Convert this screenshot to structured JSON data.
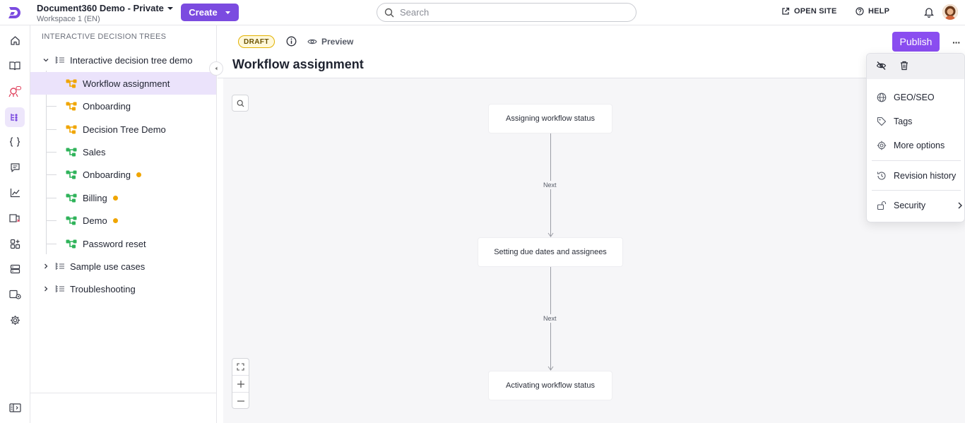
{
  "header": {
    "project_title": "Document360 Demo - Private",
    "workspace": "Workspace 1 (EN)",
    "create_label": "Create",
    "search_placeholder": "Search",
    "open_site_label": "OPEN SITE",
    "help_label": "HELP"
  },
  "rail": {
    "items": [
      "home-icon",
      "book-icon",
      "ai-assistant-icon",
      "decision-tree-icon",
      "api-braces-icon",
      "feedback-icon",
      "analytics-icon",
      "knowledge-base-icon",
      "apps-icon",
      "drive-icon",
      "widget-icon",
      "settings-icon",
      "sidebar-toggle-icon"
    ],
    "active": "decision-tree-icon"
  },
  "tree": {
    "heading": "INTERACTIVE DECISION TREES",
    "folders": [
      {
        "label": "Interactive decision tree demo",
        "expanded": true
      },
      {
        "label": "Sample use cases",
        "expanded": false
      },
      {
        "label": "Troubleshooting",
        "expanded": false
      }
    ],
    "children": [
      {
        "label": "Workflow assignment",
        "status": "draft",
        "selected": true,
        "unsaved": false
      },
      {
        "label": "Onboarding",
        "status": "draft",
        "selected": false,
        "unsaved": false
      },
      {
        "label": "Decision Tree Demo",
        "status": "draft",
        "selected": false,
        "unsaved": false
      },
      {
        "label": "Sales",
        "status": "published",
        "selected": false,
        "unsaved": false
      },
      {
        "label": "Onboarding",
        "status": "published",
        "selected": false,
        "unsaved": true
      },
      {
        "label": "Billing",
        "status": "published",
        "selected": false,
        "unsaved": true
      },
      {
        "label": "Demo",
        "status": "published",
        "selected": false,
        "unsaved": true
      },
      {
        "label": "Password reset",
        "status": "published",
        "selected": false,
        "unsaved": false
      }
    ]
  },
  "editor": {
    "status_badge": "DRAFT",
    "preview_label": "Preview",
    "publish_label": "Publish",
    "title": "Workflow assignment"
  },
  "flow": {
    "nodes": [
      "Assigning workflow status",
      "Setting due dates and assignees",
      "Activating workflow status"
    ],
    "edges": [
      "Next",
      "Next"
    ]
  },
  "menu": {
    "items": [
      "GEO/SEO",
      "Tags",
      "More options",
      "Revision history",
      "Security"
    ]
  },
  "colors": {
    "accent": "#7b4be0",
    "publish": "#8a4df0",
    "draft_icon": "#f0a500",
    "published_icon": "#2fb35a",
    "unsaved_dot": "#f0a500"
  }
}
